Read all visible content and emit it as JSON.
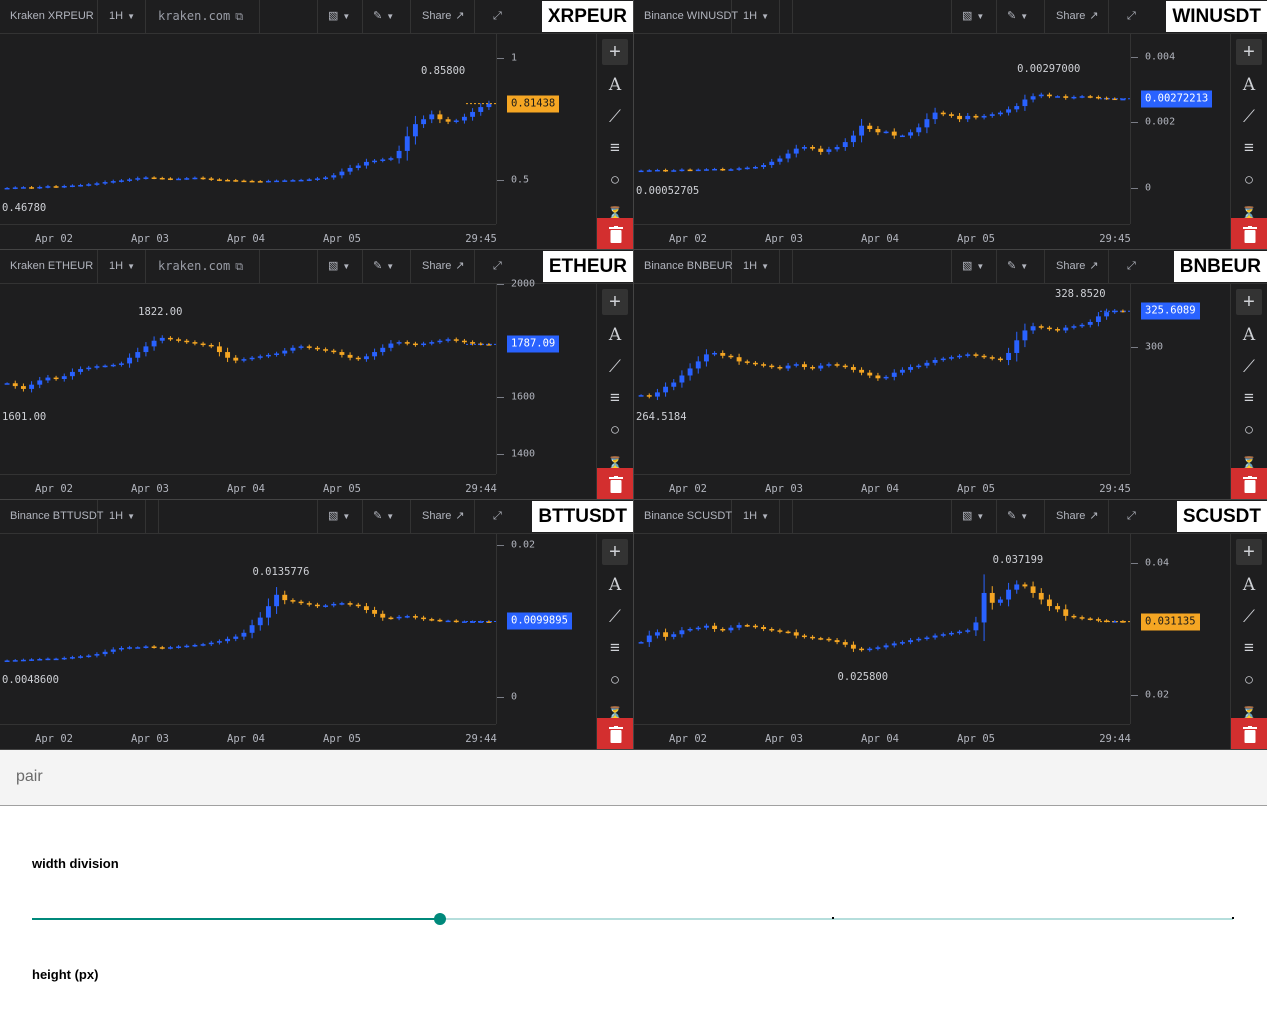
{
  "panels": [
    {
      "pair": "Kraken XRPEUR",
      "interval": "1H",
      "domain": "kraken.com",
      "symbol": "XRPEUR",
      "ymin": 0.32,
      "ymax": 1.1,
      "ticks": [
        {
          "label": "1",
          "value": 1
        },
        {
          "label": "0.5",
          "value": 0.5
        }
      ],
      "last": "0.81438",
      "last_value": 0.81438,
      "badge_color": "#f5a623",
      "badge_text_color": "#1a1a1a",
      "high": "0.85800",
      "high_value": 0.858,
      "low": "0.46780",
      "low_value": 0.4678,
      "time_labels": [
        "Apr 02",
        "Apr 03",
        "Apr 04",
        "Apr 05",
        "29:45"
      ],
      "series": [
        0.468,
        0.47,
        0.471,
        0.469,
        0.472,
        0.475,
        0.473,
        0.476,
        0.478,
        0.48,
        0.483,
        0.487,
        0.492,
        0.496,
        0.499,
        0.503,
        0.508,
        0.511,
        0.509,
        0.507,
        0.505,
        0.506,
        0.508,
        0.51,
        0.507,
        0.503,
        0.501,
        0.5,
        0.498,
        0.497,
        0.496,
        0.495,
        0.497,
        0.498,
        0.499,
        0.5,
        0.501,
        0.503,
        0.507,
        0.511,
        0.52,
        0.535,
        0.55,
        0.56,
        0.575,
        0.58,
        0.585,
        0.59,
        0.62,
        0.68,
        0.73,
        0.75,
        0.77,
        0.75,
        0.74,
        0.745,
        0.76,
        0.78,
        0.8,
        0.814
      ]
    },
    {
      "pair": "Binance WINUSDT",
      "interval": "1H",
      "domain": "",
      "symbol": "WINUSDT",
      "ymin": -0.0011,
      "ymax": 0.0047,
      "ticks": [
        {
          "label": "0.004",
          "value": 0.004
        },
        {
          "label": "0.002",
          "value": 0.002
        },
        {
          "label": "0",
          "value": 0
        }
      ],
      "last": "0.00272213",
      "last_value": 0.00272213,
      "badge_color": "#2962ff",
      "badge_text_color": "#ffffff",
      "high": "0.00297000",
      "high_value": 0.00297,
      "low": "0.00052705",
      "low_value": 0.00052705,
      "time_labels": [
        "Apr 02",
        "Apr 03",
        "Apr 04",
        "Apr 05",
        "29:45"
      ],
      "series": [
        0.00053,
        0.00054,
        0.00055,
        0.00053,
        0.00054,
        0.00056,
        0.00055,
        0.00056,
        0.00057,
        0.00058,
        0.00056,
        0.00057,
        0.0006,
        0.00062,
        0.00064,
        0.0007,
        0.0008,
        0.0009,
        0.00105,
        0.0012,
        0.00125,
        0.0012,
        0.0011,
        0.00118,
        0.00125,
        0.0014,
        0.0016,
        0.0019,
        0.0018,
        0.0017,
        0.00172,
        0.0016,
        0.0016,
        0.0017,
        0.00185,
        0.0021,
        0.0023,
        0.00225,
        0.0022,
        0.0021,
        0.0022,
        0.00215,
        0.0022,
        0.00225,
        0.0023,
        0.0024,
        0.0025,
        0.0027,
        0.0028,
        0.00285,
        0.0028,
        0.0028,
        0.00275,
        0.00278,
        0.0028,
        0.00278,
        0.00275,
        0.00273,
        0.00272,
        0.00272
      ]
    },
    {
      "pair": "Kraken ETHEUR",
      "interval": "1H",
      "domain": "kraken.com",
      "symbol": "ETHEUR",
      "ymin": 1330,
      "ymax": 2000,
      "ticks": [
        {
          "label": "2000",
          "value": 2000
        },
        {
          "label": "1600",
          "value": 1600
        },
        {
          "label": "1400",
          "value": 1400
        }
      ],
      "last": "1787.09",
      "last_value": 1787.09,
      "badge_color": "#2962ff",
      "badge_text_color": "#ffffff",
      "high": "1822.00",
      "high_value": 1822,
      "low": "1601.00",
      "low_value": 1601,
      "time_labels": [
        "Apr 02",
        "Apr 03",
        "Apr 04",
        "Apr 05",
        "29:44"
      ],
      "series": [
        1650,
        1640,
        1630,
        1645,
        1660,
        1670,
        1665,
        1675,
        1690,
        1700,
        1705,
        1710,
        1712,
        1715,
        1720,
        1740,
        1760,
        1780,
        1800,
        1810,
        1805,
        1800,
        1795,
        1790,
        1785,
        1780,
        1760,
        1740,
        1730,
        1735,
        1740,
        1745,
        1750,
        1755,
        1765,
        1775,
        1780,
        1775,
        1770,
        1765,
        1760,
        1750,
        1740,
        1735,
        1745,
        1760,
        1775,
        1790,
        1795,
        1790,
        1785,
        1790,
        1795,
        1800,
        1805,
        1800,
        1795,
        1790,
        1788,
        1787
      ]
    },
    {
      "pair": "Binance BNBEUR",
      "interval": "1H",
      "domain": "",
      "symbol": "BNBEUR",
      "ymin": 210,
      "ymax": 345,
      "ticks": [
        {
          "label": "300",
          "value": 300
        }
      ],
      "last": "325.6089",
      "last_value": 325.6089,
      "badge_color": "#2962ff",
      "badge_text_color": "#ffffff",
      "high": "328.8520",
      "high_value": 328.852,
      "low": "264.5184",
      "low_value": 264.5184,
      "time_labels": [
        "Apr 02",
        "Apr 03",
        "Apr 04",
        "Apr 05",
        "29:45"
      ],
      "series": [
        266,
        265,
        268,
        272,
        275,
        280,
        285,
        290,
        295,
        296,
        294,
        293,
        290,
        289,
        288,
        287,
        286,
        285,
        287,
        288,
        286,
        285,
        287,
        288,
        287,
        286,
        284,
        282,
        280,
        278,
        279,
        282,
        284,
        286,
        287,
        289,
        291,
        292,
        293,
        294,
        295,
        294,
        293,
        292,
        291,
        296,
        305,
        312,
        315,
        314,
        313,
        312,
        314,
        315,
        316,
        318,
        322,
        325,
        326,
        325.6
      ]
    },
    {
      "pair": "Binance BTTUSDT",
      "interval": "1H",
      "domain": "",
      "symbol": "BTTUSDT",
      "ymin": -0.0035,
      "ymax": 0.0215,
      "ticks": [
        {
          "label": "0.02",
          "value": 0.02
        },
        {
          "label": "0",
          "value": 0
        }
      ],
      "last": "0.0099895",
      "last_value": 0.0099895,
      "badge_color": "#2962ff",
      "badge_text_color": "#ffffff",
      "high": "0.0135776",
      "high_value": 0.0135776,
      "low": "0.0048600",
      "low_value": 0.00486,
      "time_labels": [
        "Apr 02",
        "Apr 03",
        "Apr 04",
        "Apr 05",
        "29:44"
      ],
      "series": [
        0.00486,
        0.0049,
        0.00495,
        0.005,
        0.00505,
        0.0051,
        0.0051,
        0.0052,
        0.0053,
        0.0054,
        0.0055,
        0.0057,
        0.006,
        0.0063,
        0.0065,
        0.0066,
        0.0066,
        0.0067,
        0.0066,
        0.0065,
        0.0066,
        0.0067,
        0.0068,
        0.0069,
        0.007,
        0.0072,
        0.0074,
        0.0077,
        0.008,
        0.0085,
        0.0095,
        0.0105,
        0.012,
        0.0135,
        0.0128,
        0.0126,
        0.0124,
        0.0122,
        0.012,
        0.0121,
        0.0123,
        0.0124,
        0.0122,
        0.012,
        0.0115,
        0.011,
        0.0105,
        0.0104,
        0.0106,
        0.0107,
        0.0105,
        0.0103,
        0.0102,
        0.0101,
        0.0101,
        0.01,
        0.01,
        0.01,
        0.01,
        0.0099895
      ]
    },
    {
      "pair": "Binance SCUSDT",
      "interval": "1H",
      "domain": "",
      "symbol": "SCUSDT",
      "ymin": 0.0155,
      "ymax": 0.0445,
      "ticks": [
        {
          "label": "0.04",
          "value": 0.04
        },
        {
          "label": "0.02",
          "value": 0.02
        }
      ],
      "last": "0.031135",
      "last_value": 0.031135,
      "badge_color": "#f5a623",
      "badge_text_color": "#1a1a1a",
      "high": "0.037199",
      "high_value": 0.037199,
      "low": "0.025800",
      "low_value": 0.0258,
      "time_labels": [
        "Apr 02",
        "Apr 03",
        "Apr 04",
        "Apr 05",
        "29:44"
      ],
      "series": [
        0.028,
        0.029,
        0.0295,
        0.0288,
        0.0292,
        0.0298,
        0.03,
        0.0302,
        0.0305,
        0.03,
        0.0298,
        0.0302,
        0.0306,
        0.0305,
        0.0303,
        0.03,
        0.0298,
        0.0296,
        0.0295,
        0.029,
        0.0288,
        0.0286,
        0.0285,
        0.0283,
        0.028,
        0.0276,
        0.027,
        0.0268,
        0.027,
        0.0272,
        0.0275,
        0.0278,
        0.028,
        0.0283,
        0.0285,
        0.0287,
        0.029,
        0.0292,
        0.0294,
        0.0296,
        0.0298,
        0.031,
        0.0355,
        0.034,
        0.0345,
        0.036,
        0.0368,
        0.0365,
        0.0355,
        0.0345,
        0.0335,
        0.033,
        0.032,
        0.0318,
        0.0316,
        0.0315,
        0.0313,
        0.0312,
        0.0312,
        0.031135
      ]
    }
  ],
  "share_label": "Share",
  "form": {
    "pair_label": "pair",
    "width_label": "width division",
    "width_value": 0.34,
    "width_stops": [
      0.667,
      1.0
    ],
    "height_label": "height (px)"
  },
  "colors": {
    "up": "#2962ff",
    "down": "#f5a623",
    "panel_bg": "#1e1e1f",
    "trash": "#d32f2f",
    "slider": "#00897b"
  }
}
